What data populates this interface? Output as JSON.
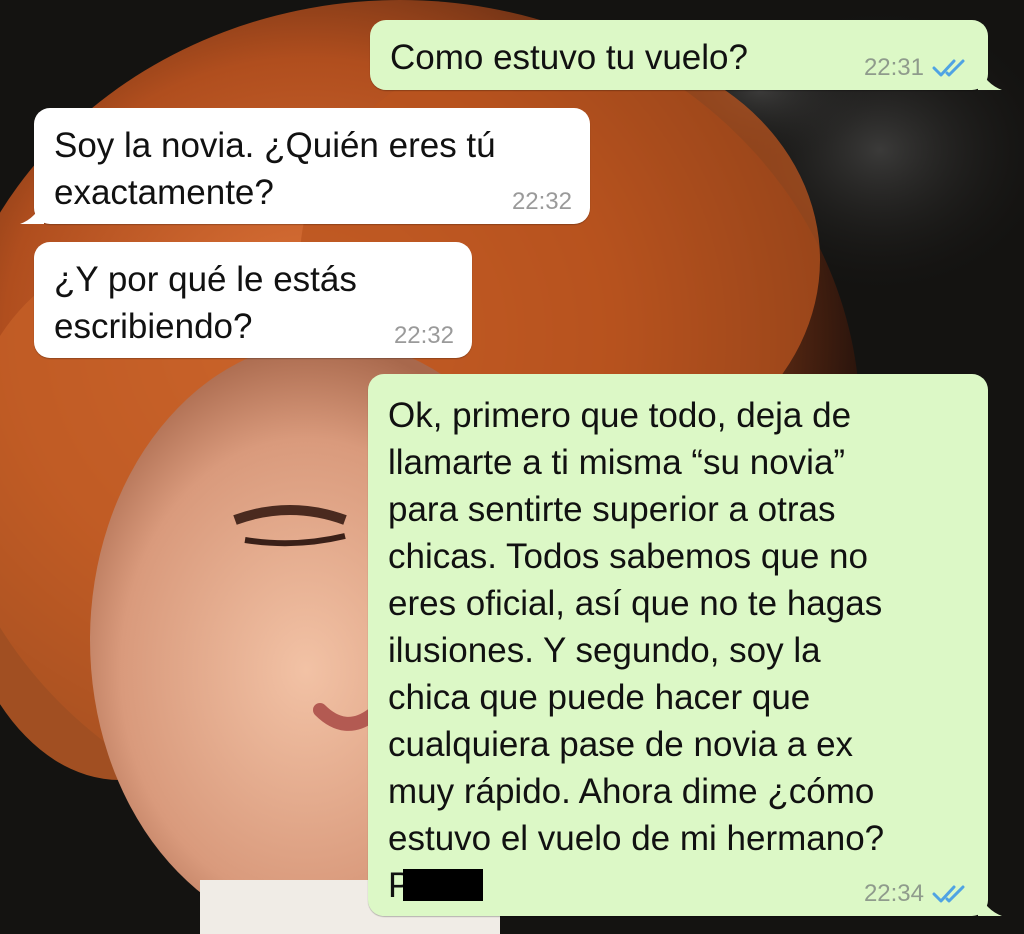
{
  "colors": {
    "outgoing_bubble": "#dcf8c6",
    "incoming_bubble": "#ffffff",
    "read_ticks": "#4fa3e3",
    "timestamp": "#8f9b8c"
  },
  "messages": [
    {
      "direction": "outgoing",
      "text": "Como estuvo tu vuelo?",
      "time": "22:31",
      "status_icon": "double-check-read-icon"
    },
    {
      "direction": "incoming",
      "text": "Soy la novia. ¿Quién eres tú\nexactamente?",
      "time": "22:32"
    },
    {
      "direction": "incoming",
      "text": "¿Y por qué le estás\nescribiendo?",
      "time": "22:32"
    },
    {
      "direction": "outgoing",
      "text": "Ok, primero que todo, deja de\nllamarte a ti misma “su novia”\npara sentirte superior a otras\nchicas. Todos sabemos que no\neres oficial, así que no te hagas\nilusiones. Y segundo, soy la\nchica que puede hacer que\ncualquiera pase de novia a ex\nmuy rápido. Ahora dime ¿cómo\nestuvo el vuelo de mi hermano?",
      "signature_visible": "P",
      "time": "22:34",
      "status_icon": "double-check-read-icon"
    }
  ]
}
